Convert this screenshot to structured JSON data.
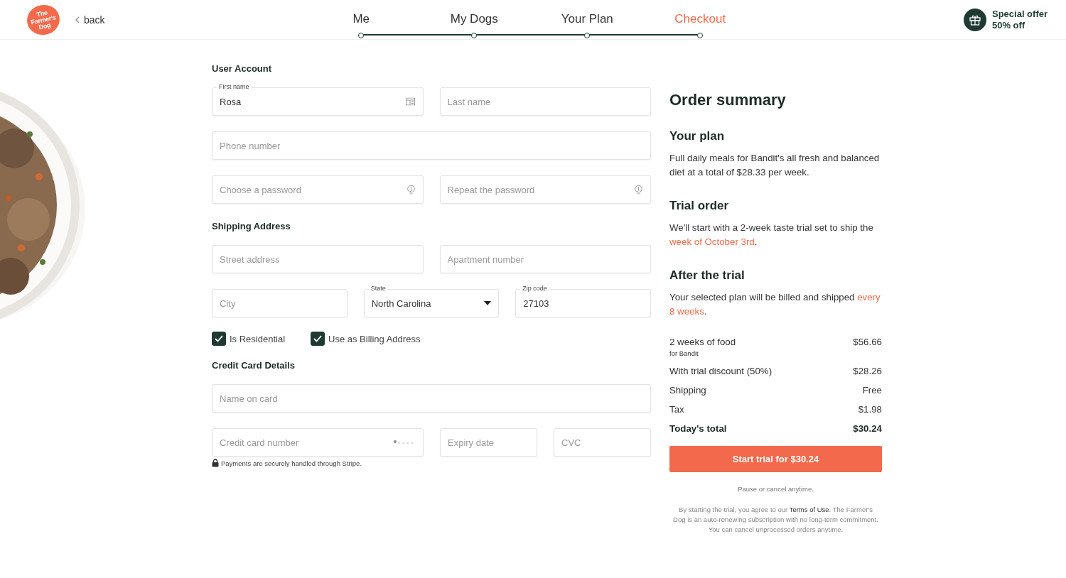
{
  "header": {
    "logo": "The Farmer's Dog",
    "back": "back",
    "steps": [
      {
        "label": "Me",
        "selected": false
      },
      {
        "label": "My Dogs",
        "selected": false
      },
      {
        "label": "Your Plan",
        "selected": false
      },
      {
        "label": "Checkout",
        "selected": true
      }
    ],
    "offer": [
      "Special offer",
      "50% off"
    ]
  },
  "form": {
    "sections": [
      {
        "title": "User Account",
        "rows": [
          {
            "kind": "pair",
            "fields": [
              {
                "kind": "contact",
                "label": "First name",
                "value": "Rosa"
              },
              {
                "kind": "text",
                "placeholder": "Last name"
              }
            ]
          },
          {
            "kind": "single",
            "fields": [
              {
                "kind": "text",
                "placeholder": "Phone number"
              }
            ]
          },
          {
            "kind": "pair",
            "fields": [
              {
                "kind": "password",
                "placeholder": "Choose a password"
              },
              {
                "kind": "password",
                "placeholder": "Repeat the password"
              }
            ]
          }
        ]
      },
      {
        "title": "Shipping Address",
        "rows": [
          {
            "kind": "pair",
            "fields": [
              {
                "kind": "text",
                "placeholder": "Street address"
              },
              {
                "kind": "text",
                "placeholder": "Apartment number"
              }
            ]
          },
          {
            "kind": "triple",
            "fields": [
              {
                "kind": "text",
                "placeholder": "City"
              },
              {
                "kind": "select",
                "label": "State",
                "value": "North Carolina"
              },
              {
                "kind": "text",
                "label": "Zip code",
                "value": "27103"
              }
            ]
          }
        ],
        "checks": [
          {
            "label": "Is Residential",
            "checked": true
          },
          {
            "label": "Use as Billing Address",
            "checked": true
          }
        ]
      },
      {
        "title": "Credit Card Details",
        "rows": [
          {
            "kind": "single",
            "fields": [
              {
                "kind": "text",
                "placeholder": "Name on card"
              }
            ]
          },
          {
            "kind": "card",
            "fields": [
              {
                "kind": "cardnumber",
                "placeholder": "Credit card number"
              },
              {
                "kind": "text",
                "placeholder": "Expiry date"
              },
              {
                "kind": "text",
                "placeholder": "CVC"
              }
            ]
          }
        ],
        "note": "Payments are securely handled through Stripe."
      }
    ]
  },
  "summary": {
    "title": "Order summary",
    "blocks": [
      {
        "heading": "Your plan",
        "text": "Full daily meals for Bandit's all fresh and balanced diet at a total of $28.33 per week."
      },
      {
        "heading": "Trial order",
        "text": "We'll start with a 2-week taste trial set to ship the ",
        "highlight": "week of October 3rd",
        "after": "."
      },
      {
        "heading": "After the trial",
        "text": "Your selected plan will be billed and shipped ",
        "highlight": "every 8 weeks",
        "after": "."
      }
    ],
    "lines": [
      {
        "kind": "item",
        "label": "2 weeks of food",
        "sub": "for Bandit",
        "amount": "$56.66"
      },
      {
        "kind": "item",
        "label": "With trial discount (50%)",
        "amount": "$28.26"
      },
      {
        "kind": "item",
        "label": "Shipping",
        "amount": "Free"
      },
      {
        "kind": "item",
        "label": "Tax",
        "amount": "$1.98"
      },
      {
        "kind": "total",
        "label": "Today's total",
        "amount": "$30.24"
      }
    ],
    "button": "Start trial for $30.24",
    "pause": "Pause or cancel anytime.",
    "legal": {
      "before": "By starting the trial, you agree to our ",
      "link": "Terms of Use",
      "after": ". The Farmer's Dog is an auto-renewing subscription with no long-term commitment. You can cancel unprocessed orders anytime."
    }
  }
}
